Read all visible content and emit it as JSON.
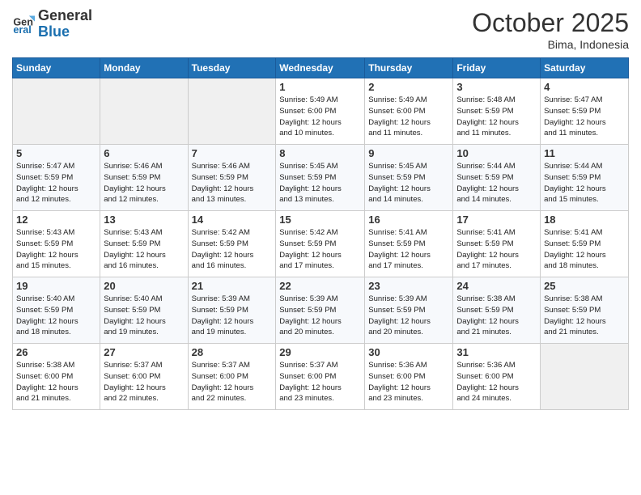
{
  "header": {
    "logo_general": "General",
    "logo_blue": "Blue",
    "month": "October 2025",
    "location": "Bima, Indonesia"
  },
  "weekdays": [
    "Sunday",
    "Monday",
    "Tuesday",
    "Wednesday",
    "Thursday",
    "Friday",
    "Saturday"
  ],
  "weeks": [
    [
      {
        "day": "",
        "info": ""
      },
      {
        "day": "",
        "info": ""
      },
      {
        "day": "",
        "info": ""
      },
      {
        "day": "1",
        "info": "Sunrise: 5:49 AM\nSunset: 6:00 PM\nDaylight: 12 hours\nand 10 minutes."
      },
      {
        "day": "2",
        "info": "Sunrise: 5:49 AM\nSunset: 6:00 PM\nDaylight: 12 hours\nand 11 minutes."
      },
      {
        "day": "3",
        "info": "Sunrise: 5:48 AM\nSunset: 5:59 PM\nDaylight: 12 hours\nand 11 minutes."
      },
      {
        "day": "4",
        "info": "Sunrise: 5:47 AM\nSunset: 5:59 PM\nDaylight: 12 hours\nand 11 minutes."
      }
    ],
    [
      {
        "day": "5",
        "info": "Sunrise: 5:47 AM\nSunset: 5:59 PM\nDaylight: 12 hours\nand 12 minutes."
      },
      {
        "day": "6",
        "info": "Sunrise: 5:46 AM\nSunset: 5:59 PM\nDaylight: 12 hours\nand 12 minutes."
      },
      {
        "day": "7",
        "info": "Sunrise: 5:46 AM\nSunset: 5:59 PM\nDaylight: 12 hours\nand 13 minutes."
      },
      {
        "day": "8",
        "info": "Sunrise: 5:45 AM\nSunset: 5:59 PM\nDaylight: 12 hours\nand 13 minutes."
      },
      {
        "day": "9",
        "info": "Sunrise: 5:45 AM\nSunset: 5:59 PM\nDaylight: 12 hours\nand 14 minutes."
      },
      {
        "day": "10",
        "info": "Sunrise: 5:44 AM\nSunset: 5:59 PM\nDaylight: 12 hours\nand 14 minutes."
      },
      {
        "day": "11",
        "info": "Sunrise: 5:44 AM\nSunset: 5:59 PM\nDaylight: 12 hours\nand 15 minutes."
      }
    ],
    [
      {
        "day": "12",
        "info": "Sunrise: 5:43 AM\nSunset: 5:59 PM\nDaylight: 12 hours\nand 15 minutes."
      },
      {
        "day": "13",
        "info": "Sunrise: 5:43 AM\nSunset: 5:59 PM\nDaylight: 12 hours\nand 16 minutes."
      },
      {
        "day": "14",
        "info": "Sunrise: 5:42 AM\nSunset: 5:59 PM\nDaylight: 12 hours\nand 16 minutes."
      },
      {
        "day": "15",
        "info": "Sunrise: 5:42 AM\nSunset: 5:59 PM\nDaylight: 12 hours\nand 17 minutes."
      },
      {
        "day": "16",
        "info": "Sunrise: 5:41 AM\nSunset: 5:59 PM\nDaylight: 12 hours\nand 17 minutes."
      },
      {
        "day": "17",
        "info": "Sunrise: 5:41 AM\nSunset: 5:59 PM\nDaylight: 12 hours\nand 17 minutes."
      },
      {
        "day": "18",
        "info": "Sunrise: 5:41 AM\nSunset: 5:59 PM\nDaylight: 12 hours\nand 18 minutes."
      }
    ],
    [
      {
        "day": "19",
        "info": "Sunrise: 5:40 AM\nSunset: 5:59 PM\nDaylight: 12 hours\nand 18 minutes."
      },
      {
        "day": "20",
        "info": "Sunrise: 5:40 AM\nSunset: 5:59 PM\nDaylight: 12 hours\nand 19 minutes."
      },
      {
        "day": "21",
        "info": "Sunrise: 5:39 AM\nSunset: 5:59 PM\nDaylight: 12 hours\nand 19 minutes."
      },
      {
        "day": "22",
        "info": "Sunrise: 5:39 AM\nSunset: 5:59 PM\nDaylight: 12 hours\nand 20 minutes."
      },
      {
        "day": "23",
        "info": "Sunrise: 5:39 AM\nSunset: 5:59 PM\nDaylight: 12 hours\nand 20 minutes."
      },
      {
        "day": "24",
        "info": "Sunrise: 5:38 AM\nSunset: 5:59 PM\nDaylight: 12 hours\nand 21 minutes."
      },
      {
        "day": "25",
        "info": "Sunrise: 5:38 AM\nSunset: 5:59 PM\nDaylight: 12 hours\nand 21 minutes."
      }
    ],
    [
      {
        "day": "26",
        "info": "Sunrise: 5:38 AM\nSunset: 6:00 PM\nDaylight: 12 hours\nand 21 minutes."
      },
      {
        "day": "27",
        "info": "Sunrise: 5:37 AM\nSunset: 6:00 PM\nDaylight: 12 hours\nand 22 minutes."
      },
      {
        "day": "28",
        "info": "Sunrise: 5:37 AM\nSunset: 6:00 PM\nDaylight: 12 hours\nand 22 minutes."
      },
      {
        "day": "29",
        "info": "Sunrise: 5:37 AM\nSunset: 6:00 PM\nDaylight: 12 hours\nand 23 minutes."
      },
      {
        "day": "30",
        "info": "Sunrise: 5:36 AM\nSunset: 6:00 PM\nDaylight: 12 hours\nand 23 minutes."
      },
      {
        "day": "31",
        "info": "Sunrise: 5:36 AM\nSunset: 6:00 PM\nDaylight: 12 hours\nand 24 minutes."
      },
      {
        "day": "",
        "info": ""
      }
    ]
  ]
}
